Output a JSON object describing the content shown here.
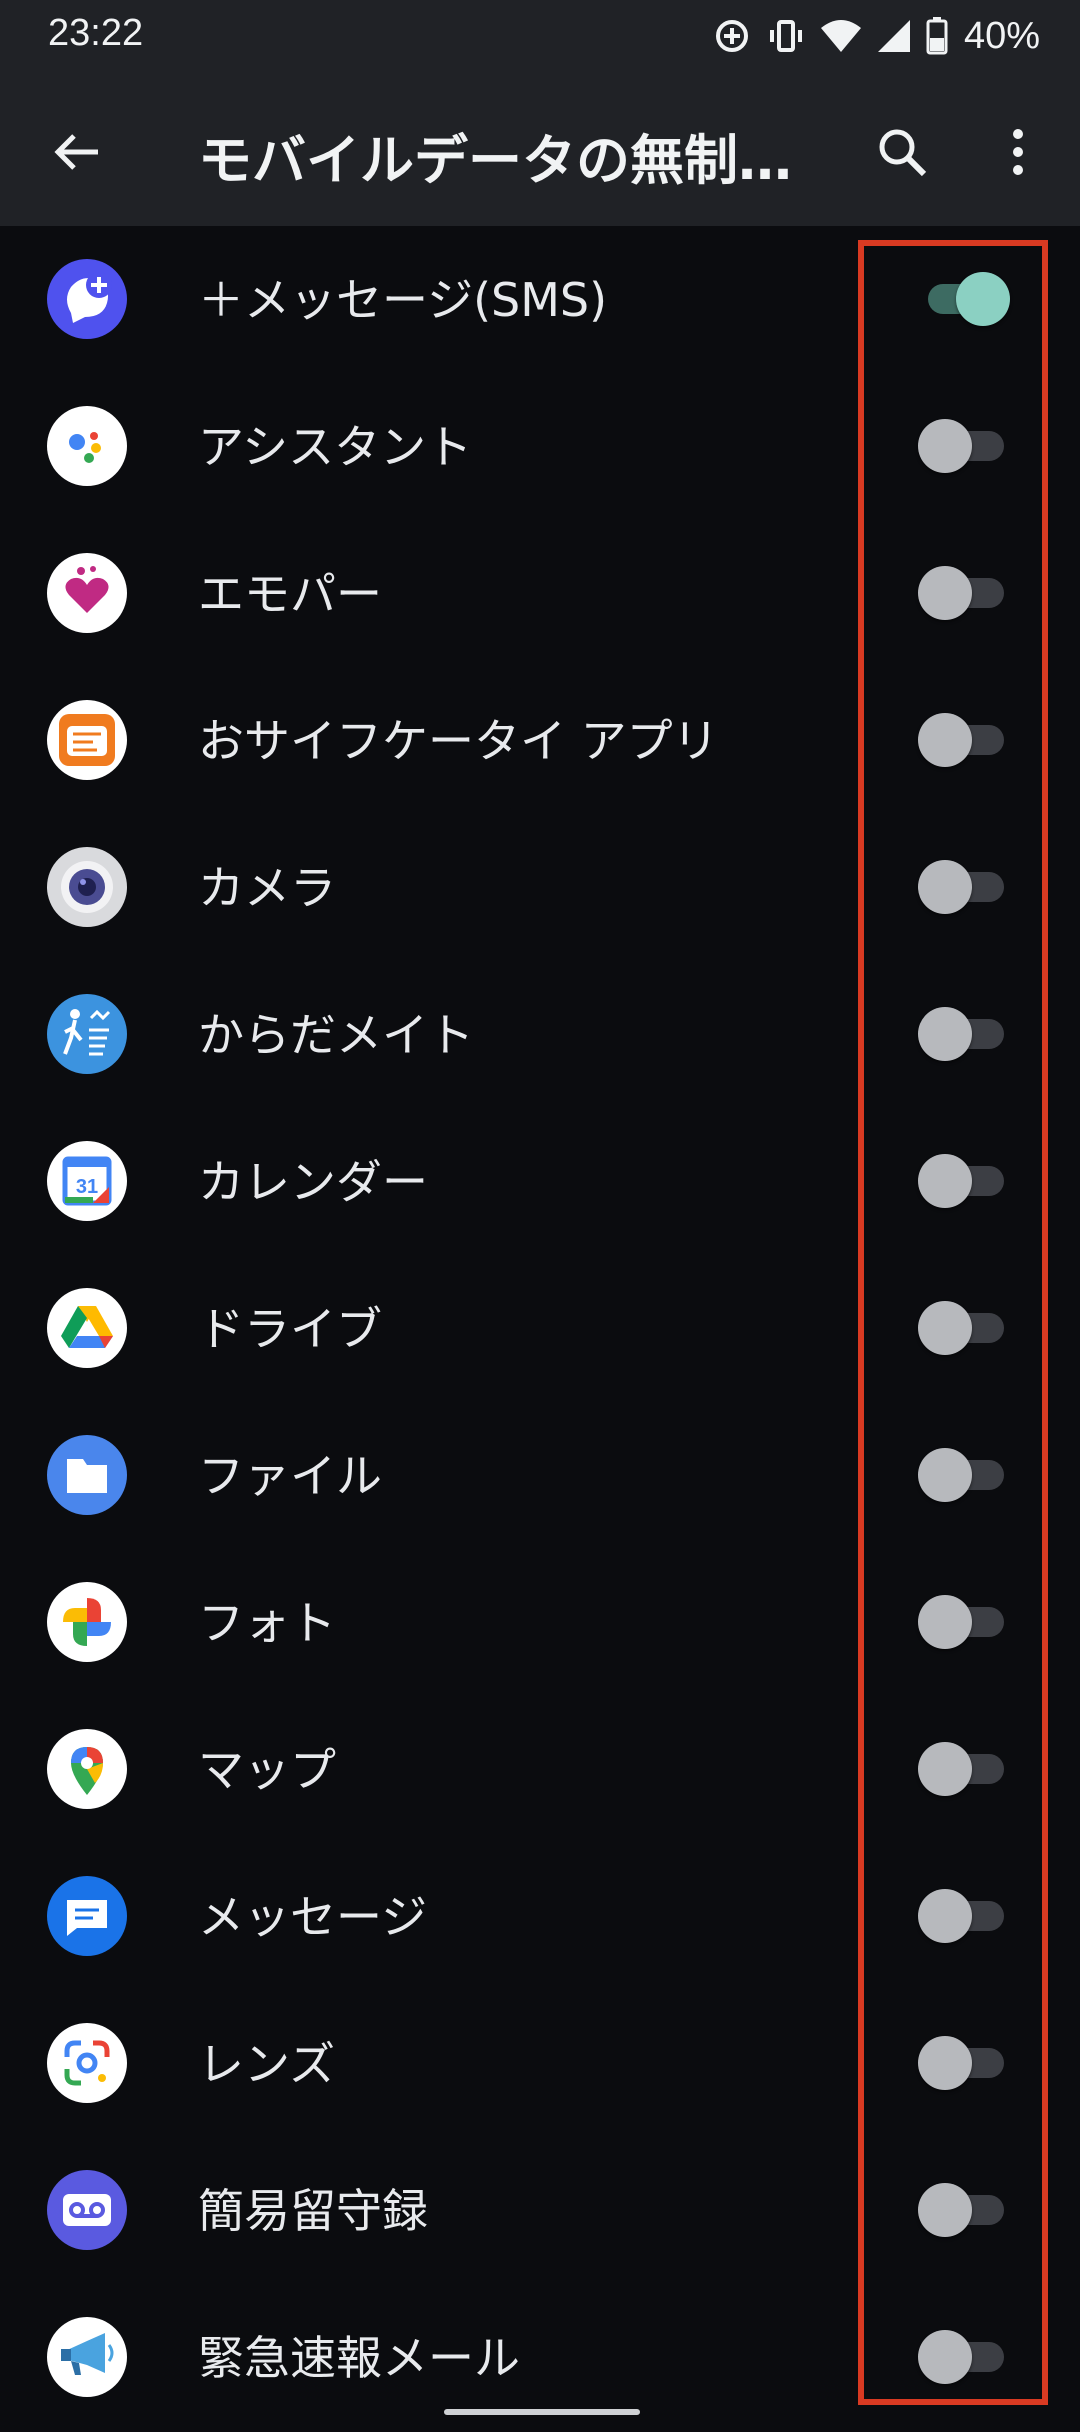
{
  "status_bar": {
    "time": "23:22",
    "battery": "40%",
    "icons": [
      "data-saver-icon",
      "vibrate-icon",
      "wifi-icon",
      "signal-icon",
      "battery-icon"
    ]
  },
  "app_bar": {
    "title": "モバイルデータの無制…",
    "icons": [
      "back-arrow-icon",
      "search-icon",
      "more-vert-icon"
    ]
  },
  "colors": {
    "toggle_on_thumb": "#8bd0c2",
    "toggle_on_track": "#3d6b62",
    "toggle_off_thumb": "#b7b9bd",
    "toggle_off_track": "#3c3e44",
    "highlight": "#d93a22"
  },
  "apps": [
    {
      "label": "＋メッセージ(SMS)",
      "icon": "plus-message-icon",
      "enabled": true
    },
    {
      "label": "アシスタント",
      "icon": "assistant-icon",
      "enabled": false
    },
    {
      "label": "エモパー",
      "icon": "emopa-icon",
      "enabled": false
    },
    {
      "label": "おサイフケータイ アプリ",
      "icon": "osaifu-keitai-icon",
      "enabled": false
    },
    {
      "label": "カメラ",
      "icon": "camera-icon",
      "enabled": false
    },
    {
      "label": "からだメイト",
      "icon": "karada-mate-icon",
      "enabled": false
    },
    {
      "label": "カレンダー",
      "icon": "calendar-icon",
      "enabled": false,
      "icon_text": "31"
    },
    {
      "label": "ドライブ",
      "icon": "drive-icon",
      "enabled": false
    },
    {
      "label": "ファイル",
      "icon": "files-icon",
      "enabled": false
    },
    {
      "label": "フォト",
      "icon": "photos-icon",
      "enabled": false
    },
    {
      "label": "マップ",
      "icon": "maps-icon",
      "enabled": false
    },
    {
      "label": "メッセージ",
      "icon": "messages-icon",
      "enabled": false
    },
    {
      "label": "レンズ",
      "icon": "lens-icon",
      "enabled": false
    },
    {
      "label": "簡易留守録",
      "icon": "voicemail-icon",
      "enabled": false
    },
    {
      "label": "緊急速報メール",
      "icon": "emergency-alert-icon",
      "enabled": false
    }
  ]
}
